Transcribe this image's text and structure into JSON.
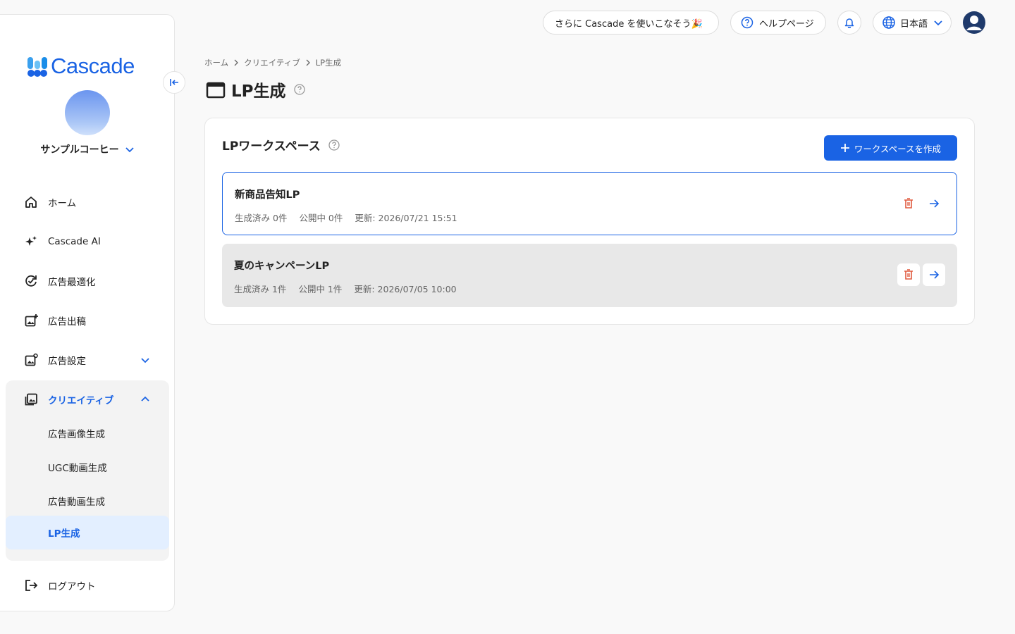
{
  "topbar": {
    "promo_label": "さらに Cascade を使いこなそう🎉",
    "help_label": "ヘルプページ",
    "language_label": "日本語"
  },
  "sidebar": {
    "logo_text": "Cascade",
    "account_name": "サンプルコーヒー",
    "items": [
      {
        "label": "ホーム",
        "icon": "home-icon"
      },
      {
        "label": "Cascade AI",
        "icon": "sparkle-icon"
      },
      {
        "label": "広告最適化",
        "icon": "optimize-icon"
      },
      {
        "label": "広告出稿",
        "icon": "ad-publish-icon"
      },
      {
        "label": "広告設定",
        "icon": "ad-settings-icon"
      },
      {
        "label": "クリエイティブ",
        "icon": "creative-icon"
      }
    ],
    "sub_items": [
      {
        "label": "広告画像生成"
      },
      {
        "label": "UGC動画生成"
      },
      {
        "label": "広告動画生成"
      },
      {
        "label": "LP生成"
      }
    ],
    "logout_label": "ログアウト"
  },
  "breadcrumb": [
    "ホーム",
    "クリエイティブ",
    "LP生成"
  ],
  "page": {
    "title": "LP生成"
  },
  "card": {
    "title": "LPワークスペース",
    "create_button_label": "ワークスペースを作成",
    "workspaces": [
      {
        "name": "新商品告知LP",
        "generated": "生成済み 0件",
        "published": "公開中 0件",
        "updated": "更新: 2026/07/21 15:51"
      },
      {
        "name": "夏のキャンペーンLP",
        "generated": "生成済み 1件",
        "published": "公開中 1件",
        "updated": "更新: 2026/07/05 10:00"
      }
    ]
  },
  "colors": {
    "accent": "#1a63e4",
    "delete": "#e05a3f",
    "active_bg": "#e3efff"
  }
}
